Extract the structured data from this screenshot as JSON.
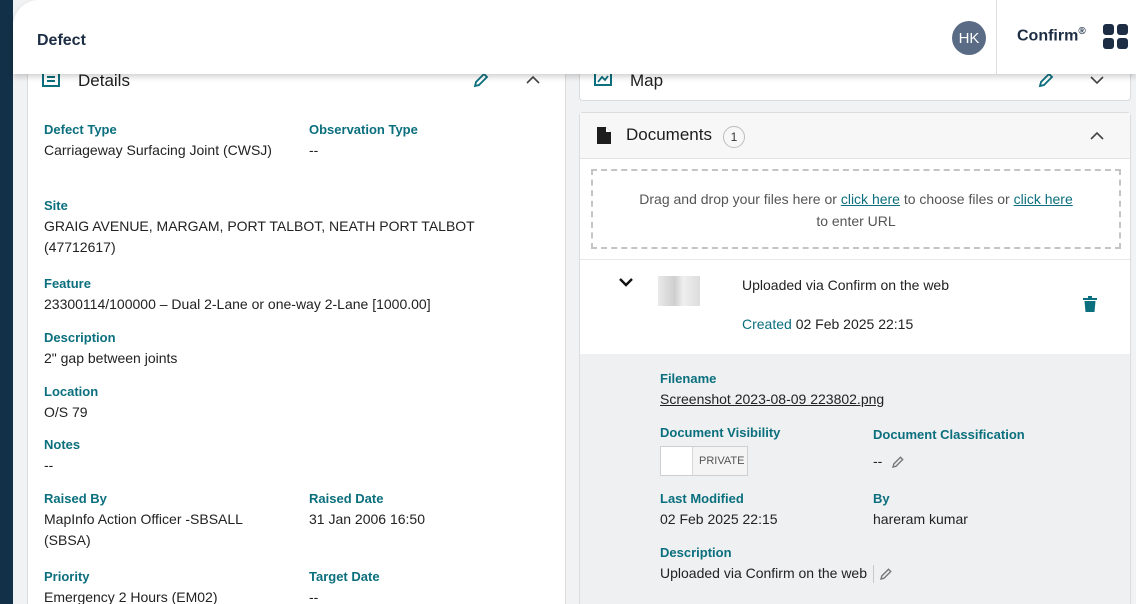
{
  "header": {
    "page_title": "Defect",
    "avatar_initials": "HK",
    "brand_name": "Confirm",
    "brand_mark": "®"
  },
  "details": {
    "title": "Details",
    "fields": {
      "defect_type": {
        "label": "Defect Type",
        "value": "Carriageway Surfacing Joint (CWSJ)"
      },
      "observation_type": {
        "label": "Observation Type",
        "value": "--"
      },
      "site": {
        "label": "Site",
        "value": "GRAIG AVENUE, MARGAM, PORT TALBOT, NEATH PORT TALBOT (47712617)"
      },
      "feature": {
        "label": "Feature",
        "value": "23300114/100000 – Dual 2-Lane or one-way 2-Lane [1000.00]"
      },
      "description": {
        "label": "Description",
        "value": "2\" gap between joints"
      },
      "location": {
        "label": "Location",
        "value": "O/S 79"
      },
      "notes": {
        "label": "Notes",
        "value": "--"
      },
      "raised_by": {
        "label": "Raised By",
        "value": "MapInfo Action Officer -SBSALL (SBSA)"
      },
      "raised_date": {
        "label": "Raised Date",
        "value": "31 Jan 2006 16:50"
      },
      "priority": {
        "label": "Priority",
        "value": "Emergency 2 Hours (EM02)"
      },
      "target_date": {
        "label": "Target Date",
        "value": "--"
      }
    }
  },
  "map": {
    "title": "Map"
  },
  "documents": {
    "title": "Documents",
    "count": "1",
    "dropzone": {
      "text_before": "Drag and drop your files here or ",
      "link1": "click here",
      "text_middle": " to choose files or ",
      "link2": "click here",
      "text_after": " to enter URL"
    },
    "item": {
      "title": "Uploaded via Confirm on the web",
      "created_label": "Created",
      "created_value": "02 Feb 2025 22:15",
      "filename_label": "Filename",
      "filename_value": "Screenshot 2023-08-09 223802.png",
      "visibility_label": "Document Visibility",
      "visibility_value": "PRIVATE",
      "classification_label": "Document Classification",
      "classification_value": "--",
      "last_modified_label": "Last Modified",
      "last_modified_value": "02 Feb 2025 22:15",
      "by_label": "By",
      "by_value": "hareram kumar",
      "description_label": "Description",
      "description_value": "Uploaded via Confirm on the web"
    }
  },
  "colors": {
    "accent": "#0b6f7d",
    "nav_dark": "#123047",
    "avatar": "#5a6b85"
  }
}
